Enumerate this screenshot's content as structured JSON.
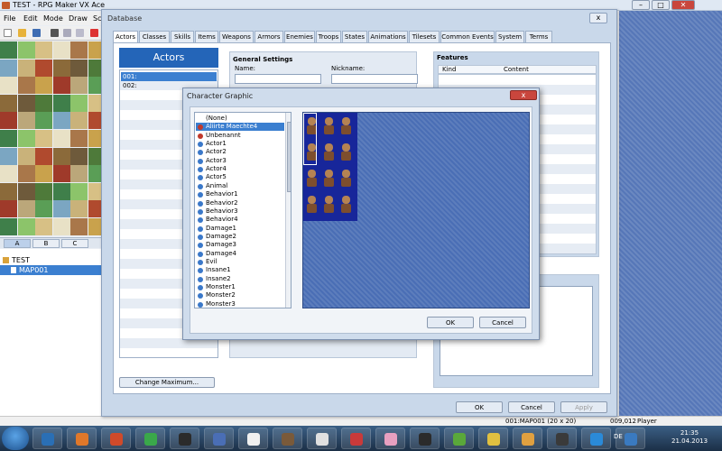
{
  "app": {
    "title": "TEST - RPG Maker VX Ace",
    "menu": [
      "File",
      "Edit",
      "Mode",
      "Draw",
      "Sca"
    ],
    "tile_tabs": [
      "A",
      "B",
      "C"
    ],
    "map_tree": {
      "project": "TEST",
      "map": "MAP001"
    },
    "status": {
      "map": "001:MAP001 (20 x 20)",
      "coords": "009,012",
      "player": "Player"
    }
  },
  "database": {
    "title": "Database",
    "close": "x",
    "tabs": [
      "Actors",
      "Classes",
      "Skills",
      "Items",
      "Weapons",
      "Armors",
      "Enemies",
      "Troops",
      "States",
      "Animations",
      "Tilesets",
      "Common Events",
      "System",
      "Terms"
    ],
    "active_tab": "Actors",
    "actors_header": "Actors",
    "actors": [
      "001:",
      "002:"
    ],
    "change_max": "Change Maximum...",
    "general_settings": "General Settings",
    "name_label": "Name:",
    "nickname_label": "Nickname:",
    "features": "Features",
    "features_cols": [
      "Kind",
      "Content"
    ],
    "ok": "OK",
    "cancel": "Cancel",
    "apply": "Apply"
  },
  "character_graphic": {
    "title": "Character Graphic",
    "close": "x",
    "items": [
      {
        "label": "(None)",
        "color": ""
      },
      {
        "label": "Aliirte Maechte4",
        "color": "#c0392b"
      },
      {
        "label": "Unbenannt",
        "color": "#c0392b"
      },
      {
        "label": "Actor1",
        "color": "#3a78c9"
      },
      {
        "label": "Actor2",
        "color": "#3a78c9"
      },
      {
        "label": "Actor3",
        "color": "#3a78c9"
      },
      {
        "label": "Actor4",
        "color": "#3a78c9"
      },
      {
        "label": "Actor5",
        "color": "#3a78c9"
      },
      {
        "label": "Animal",
        "color": "#3a78c9"
      },
      {
        "label": "Behavior1",
        "color": "#3a78c9"
      },
      {
        "label": "Behavior2",
        "color": "#3a78c9"
      },
      {
        "label": "Behavior3",
        "color": "#3a78c9"
      },
      {
        "label": "Behavior4",
        "color": "#3a78c9"
      },
      {
        "label": "Damage1",
        "color": "#3a78c9"
      },
      {
        "label": "Damage2",
        "color": "#3a78c9"
      },
      {
        "label": "Damage3",
        "color": "#3a78c9"
      },
      {
        "label": "Damage4",
        "color": "#3a78c9"
      },
      {
        "label": "Evil",
        "color": "#3a78c9"
      },
      {
        "label": "Insane1",
        "color": "#3a78c9"
      },
      {
        "label": "Insane2",
        "color": "#3a78c9"
      },
      {
        "label": "Monster1",
        "color": "#3a78c9"
      },
      {
        "label": "Monster2",
        "color": "#3a78c9"
      },
      {
        "label": "Monster3",
        "color": "#3a78c9"
      }
    ],
    "selected_index": 1,
    "ok": "OK",
    "cancel": "Cancel"
  },
  "taskbar": {
    "language": "DE",
    "time": "21:35",
    "date": "21.04.2013"
  }
}
